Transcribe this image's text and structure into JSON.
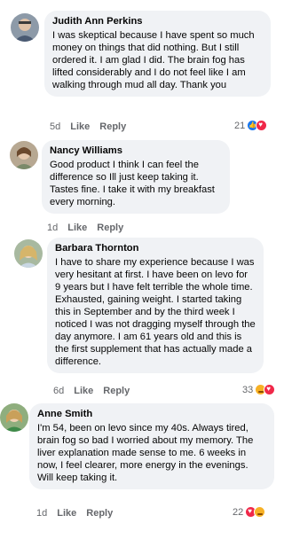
{
  "comments": [
    {
      "name": "Judith Ann Perkins",
      "text": "I was skeptical because I have spent so much money on things that did nothing. But I still ordered it. I am glad I did. The brain fog has lifted considerably and I do not feel like I am walking through mud all day. Thank you",
      "time": "5d",
      "like": "Like",
      "reply": "Reply",
      "reaction_count": "21",
      "reactions": [
        "like-icon",
        "love-icon"
      ]
    },
    {
      "name": "Nancy Williams",
      "text": "Good product I think I can feel the difference so Ill just keep taking it. Tastes fine. I take it with my breakfast every morning.",
      "time": "1d",
      "like": "Like",
      "reply": "Reply"
    },
    {
      "name": "Barbara Thornton",
      "text": "I have to share my experience because I was very hesitant at first. I have been on levo for 9 years but I have felt terrible the whole time. Exhausted, gaining weight. I started taking this in September and by the third week I noticed I was not dragging myself through the day anymore. I am 61 years old and this is the first supplement that has actually made a difference.",
      "time": "6d",
      "like": "Like",
      "reply": "Reply",
      "reaction_count": "33",
      "reactions": [
        "care-icon",
        "love-icon"
      ]
    },
    {
      "name": "Anne Smith",
      "text": "I'm 54, been on levo since my 40s. Always tired, brain fog so bad I worried about my memory. The liver explanation made sense to me. 6 weeks in now, I feel clearer, more energy in the evenings. Will keep taking it.",
      "time": "1d",
      "like": "Like",
      "reply": "Reply",
      "reaction_count": "22",
      "reactions": [
        "love-icon",
        "care-icon"
      ]
    }
  ],
  "colors": {
    "bubble": "#f0f2f5",
    "meta_text": "#65676b",
    "like_blue": "#1877f2",
    "love_red": "#f02849",
    "care_yellow": "#f7b125"
  }
}
